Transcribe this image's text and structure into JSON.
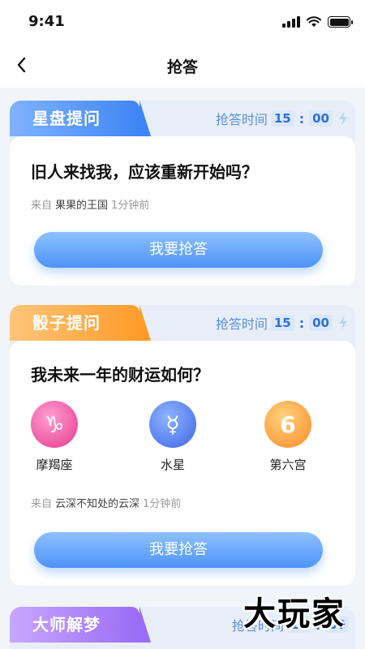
{
  "status_bar": {
    "time": "9:41"
  },
  "nav": {
    "title": "抢答"
  },
  "cards": [
    {
      "tag": "星盘提问",
      "timer_label": "抢答时间",
      "timer_min": "15",
      "timer_sep": ":",
      "timer_sec": "00",
      "question": "旧人来找我，应该重新开始吗？",
      "from_label": "来自",
      "from_user": "果果的王国",
      "from_time": "1分钟前",
      "button": "我要抢答"
    },
    {
      "tag": "骰子提问",
      "timer_label": "抢答时间",
      "timer_min": "15",
      "timer_sep": ":",
      "timer_sec": "00",
      "question": "我未来一年的财运如何？",
      "symbols": [
        {
          "glyph": "♑",
          "label": "摩羯座",
          "icon": "capricorn-icon"
        },
        {
          "glyph": "☿",
          "label": "水星",
          "icon": "mercury-icon"
        },
        {
          "glyph": "6",
          "label": "第六宫",
          "icon": "sixth-house-icon"
        }
      ],
      "from_label": "来自",
      "from_user": "云深不知处的云深",
      "from_time": "1分钟前",
      "button": "我要抢答"
    },
    {
      "tag": "大师解梦",
      "timer_label": "抢答时间",
      "timer_min": "15",
      "timer_sep": ":",
      "timer_sec": "00"
    }
  ],
  "watermark": "大玩家",
  "colors": {
    "accent": "#4d93f7",
    "orange": "#ff9c2a",
    "purple": "#9b6cf5",
    "background": "#f1f4f9"
  }
}
